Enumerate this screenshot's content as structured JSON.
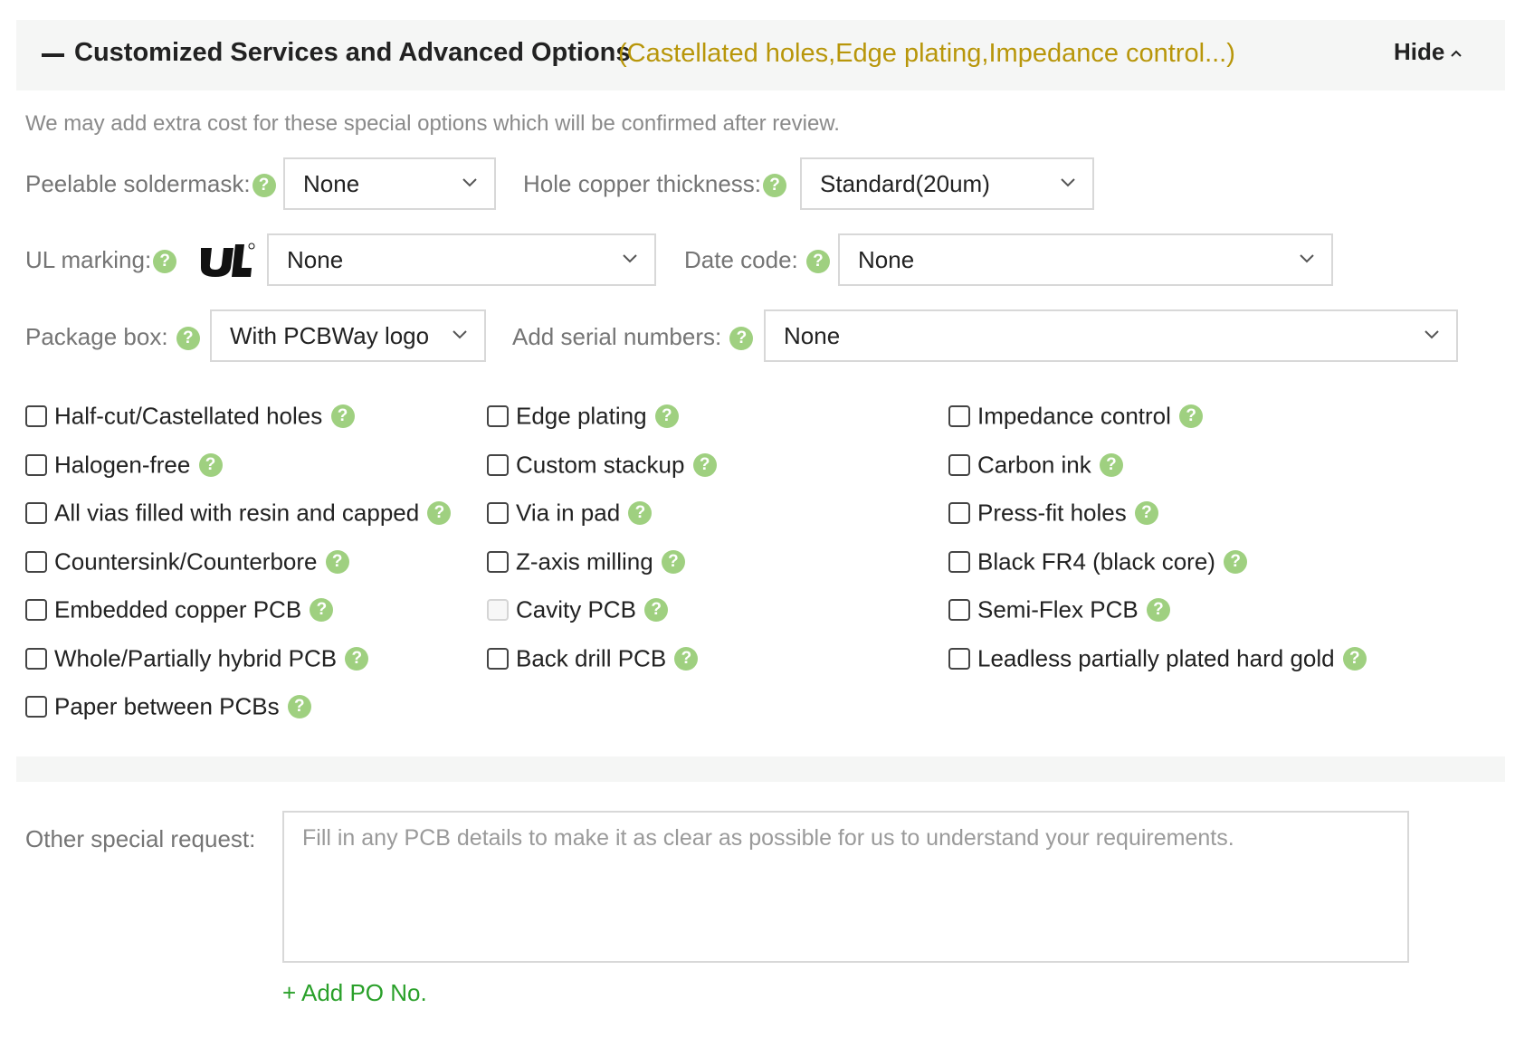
{
  "header": {
    "title": "Customized Services and Advanced Options",
    "subtitle": "(Castellated holes,Edge plating,Impedance control...)",
    "hide_label": "Hide"
  },
  "note": "We may add extra cost for these special options which will be confirmed after review.",
  "help_glyph": "?",
  "fields": {
    "peelable_soldermask": {
      "label": "Peelable soldermask:",
      "value": "None"
    },
    "hole_copper_thickness": {
      "label": "Hole copper thickness:",
      "value": "Standard(20um)"
    },
    "ul_marking": {
      "label": "UL marking:",
      "value": "None"
    },
    "date_code": {
      "label": "Date code:",
      "value": "None"
    },
    "package_box": {
      "label": "Package box:",
      "value": "With PCBWay logo"
    },
    "serial_numbers": {
      "label": "Add serial numbers:",
      "value": "None"
    }
  },
  "checkboxes": [
    {
      "label": "Half-cut/Castellated holes",
      "checked": false
    },
    {
      "label": "Edge plating",
      "checked": false
    },
    {
      "label": "Impedance control",
      "checked": false
    },
    {
      "label": "Halogen-free",
      "checked": false
    },
    {
      "label": "Custom stackup",
      "checked": false
    },
    {
      "label": "Carbon ink",
      "checked": false
    },
    {
      "label": "All vias filled with resin and capped",
      "checked": false
    },
    {
      "label": "Via in pad",
      "checked": false
    },
    {
      "label": "Press-fit holes",
      "checked": false
    },
    {
      "label": "Countersink/Counterbore",
      "checked": false
    },
    {
      "label": "Z-axis milling",
      "checked": false
    },
    {
      "label": "Black FR4 (black core)",
      "checked": false
    },
    {
      "label": "Embedded copper PCB",
      "checked": false
    },
    {
      "label": "Cavity PCB",
      "checked": false,
      "disabled": true
    },
    {
      "label": "Semi-Flex PCB",
      "checked": false
    },
    {
      "label": "Whole/Partially hybrid PCB",
      "checked": false
    },
    {
      "label": "Back drill PCB",
      "checked": false
    },
    {
      "label": "Leadless partially plated hard gold",
      "checked": false
    },
    {
      "label": "Paper between PCBs",
      "checked": false
    }
  ],
  "other_request": {
    "label": "Other special request:",
    "placeholder": "Fill in any PCB details to make it as clear as possible for us to understand your requirements.",
    "value": ""
  },
  "add_po_label": "+ Add PO No.",
  "colors": {
    "accent_green": "#2aa02a",
    "help_green": "#9fd080",
    "subtitle_gold": "#b8960a"
  },
  "icons": [
    "minus-icon",
    "chevron-up-icon",
    "chevron-down-icon",
    "help-icon",
    "ul-logo-icon"
  ]
}
